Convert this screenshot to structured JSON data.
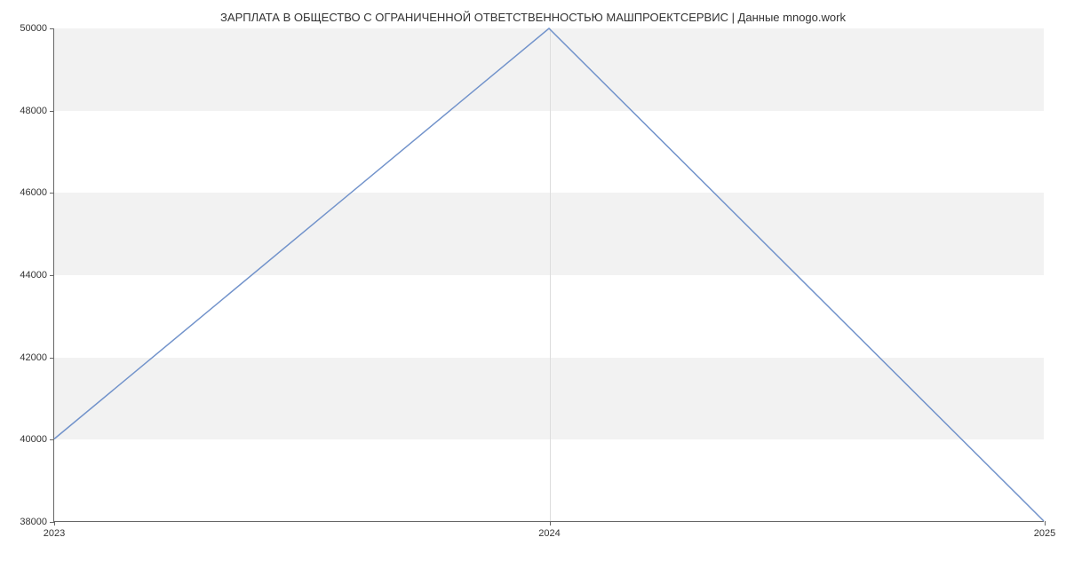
{
  "chart_data": {
    "type": "line",
    "title": "ЗАРПЛАТА В ОБЩЕСТВО С ОГРАНИЧЕННОЙ ОТВЕТСТВЕННОСТЬЮ МАШПРОЕКТСЕРВИС | Данные mnogo.work",
    "xlabel": "",
    "ylabel": "",
    "x": [
      2023,
      2024,
      2025
    ],
    "values": [
      40000,
      50000,
      38000
    ],
    "x_ticks": [
      "2023",
      "2024",
      "2025"
    ],
    "y_ticks": [
      38000,
      40000,
      42000,
      44000,
      46000,
      48000,
      50000
    ],
    "xlim": [
      2023,
      2025
    ],
    "ylim": [
      38000,
      50000
    ],
    "line_color": "#7293cb"
  }
}
